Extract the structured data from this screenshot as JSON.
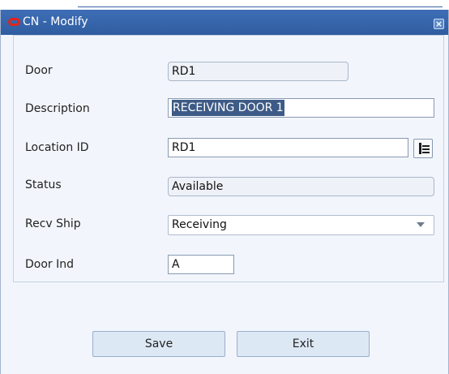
{
  "window": {
    "title": "CN - Modify",
    "close_glyph": "×"
  },
  "form": {
    "door_label": "Door",
    "door_value": "RD1",
    "description_label": "Description",
    "description_value": "RECEIVING DOOR 1",
    "location_label": "Location ID",
    "location_value": "RD1",
    "status_label": "Status",
    "status_value": "Available",
    "recv_ship_label": "Recv Ship",
    "recv_ship_value": "Receiving",
    "door_ind_label": "Door Ind",
    "door_ind_value": "A"
  },
  "actions": {
    "save_label": "Save",
    "exit_label": "Exit"
  },
  "icons": {
    "logo": "oracle-logo-icon",
    "close": "close-icon",
    "lookup": "lookup-list-icon",
    "dropdown": "chevron-down-icon"
  },
  "colors": {
    "titlebar": "#2f5d9f",
    "logo": "#e2231a",
    "selection": "#3d5b86",
    "background": "#f2f6fc"
  }
}
